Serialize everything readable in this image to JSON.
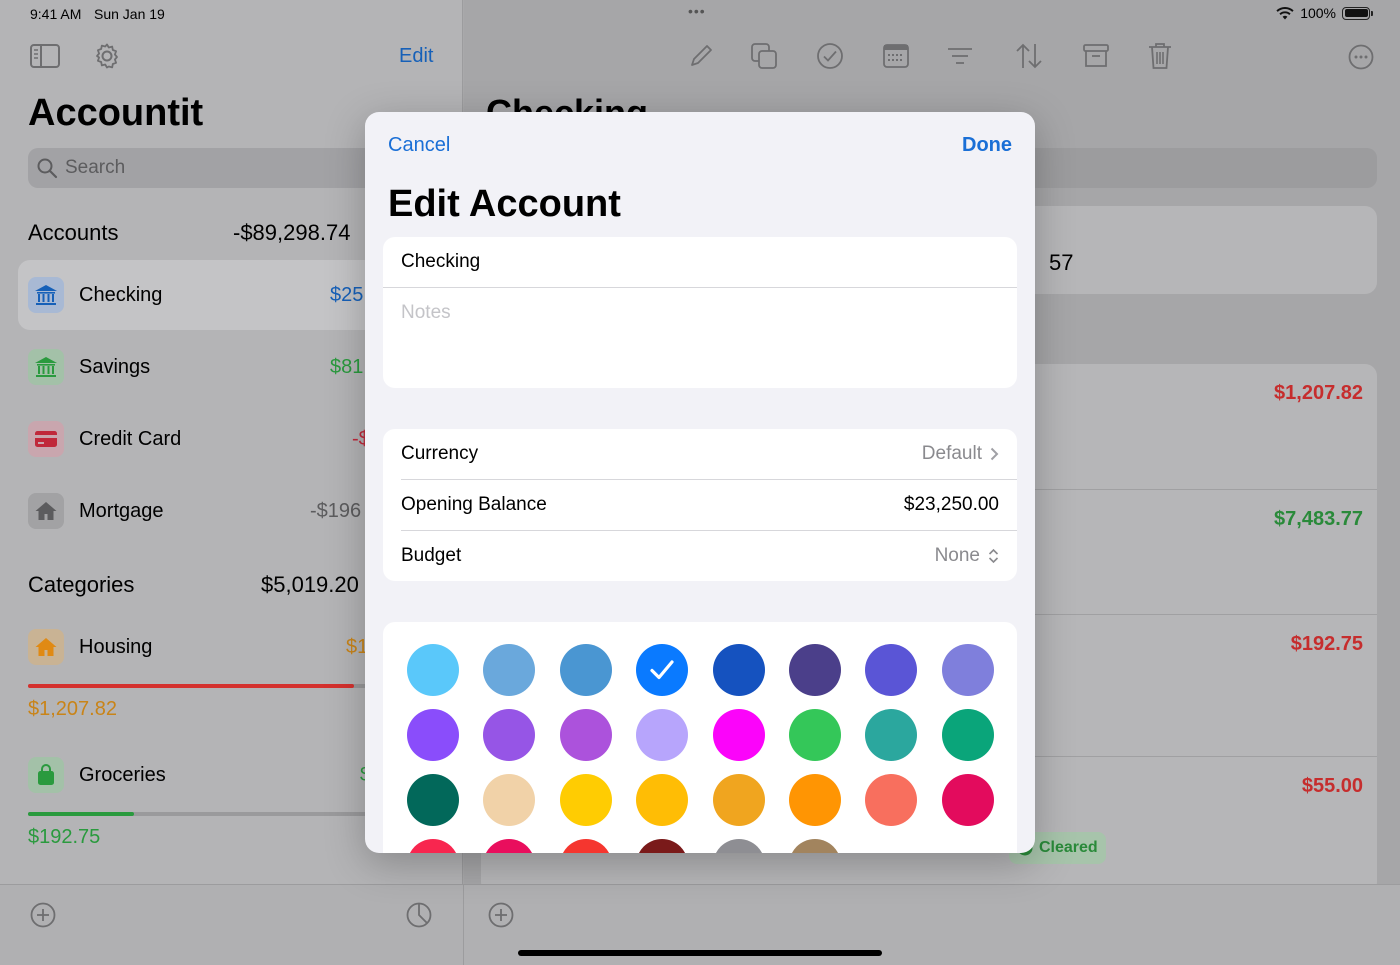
{
  "status": {
    "time": "9:41 AM",
    "date": "Sun Jan 19",
    "battery": "100%"
  },
  "sidebar": {
    "edit_label": "Edit",
    "title": "Accountit",
    "search_placeholder": "Search",
    "accounts_header": {
      "label": "Accounts",
      "total": "-$89,298.74"
    },
    "accounts": [
      {
        "name": "Checking",
        "amount": "$25",
        "color": "#1660b8",
        "icon": "bank-icon"
      },
      {
        "name": "Savings",
        "amount": "$81",
        "color": "#2a9a3e",
        "icon": "bank-icon"
      },
      {
        "name": "Credit Card",
        "amount": "-$",
        "color": "#c0283a",
        "icon": "credit-card-icon"
      },
      {
        "name": "Mortgage",
        "amount": "-$196",
        "color": "#5c5c5e",
        "icon": "house-icon"
      }
    ],
    "categories_header": {
      "label": "Categories",
      "total": "$5,019.20"
    },
    "categories": [
      {
        "name": "Housing",
        "amount": "$1",
        "spent": "$1,207.82",
        "progress": 0.74,
        "bar_color": "#d4312e",
        "text_color": "#c98418",
        "icon": "house-icon"
      },
      {
        "name": "Groceries",
        "amount": "$",
        "spent": "$192.75",
        "progress": 0.24,
        "bar_color": "#2a9a3e",
        "text_color": "#2a9a3e",
        "icon": "bag-icon"
      }
    ]
  },
  "detail": {
    "title": "Checking",
    "card_value": "57",
    "transactions": [
      {
        "amount": "$1,207.82",
        "color": "#c62d2d"
      },
      {
        "amount": "$7,483.77",
        "color": "#2a8a3a"
      },
      {
        "amount": "$192.75",
        "color": "#c62d2d"
      },
      {
        "amount": "$55.00",
        "color": "#c62d2d"
      }
    ],
    "cleared_tag": "Cleared"
  },
  "modal": {
    "cancel_label": "Cancel",
    "done_label": "Done",
    "title": "Edit Account",
    "name_value": "Checking",
    "notes_placeholder": "Notes",
    "currency": {
      "label": "Currency",
      "value": "Default"
    },
    "opening_balance": {
      "label": "Opening Balance",
      "value": "$23,250.00"
    },
    "budget": {
      "label": "Budget",
      "value": "None"
    },
    "selected_color": "#0a7aff",
    "colors": [
      "#5ac8fa",
      "#6aa8dc",
      "#4a96d2",
      "#0a7aff",
      "#1552bf",
      "#4b3f8a",
      "#5a55d6",
      "#7f7fdc",
      "#8a4dfb",
      "#9655e6",
      "#ac52dc",
      "#b7a5fc",
      "#fb04fa",
      "#34c759",
      "#2ba79e",
      "#0aa57a",
      "#02685a",
      "#f1d2a8",
      "#ffcc02",
      "#ffbd05",
      "#f0a51f",
      "#ff9503",
      "#f86f5e",
      "#e30b5d",
      "#f8264f",
      "#e90e5d",
      "#f5362f",
      "#7a1a1a",
      "#8e8e93",
      "#a2845e"
    ]
  }
}
